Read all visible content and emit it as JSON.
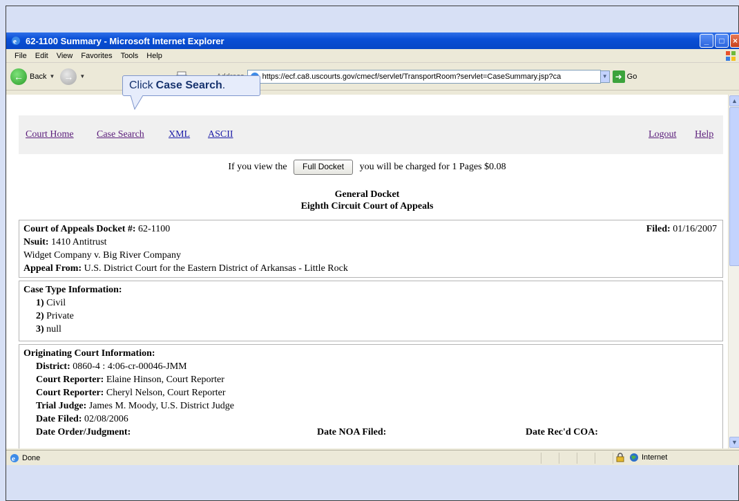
{
  "window": {
    "title": "62-1100 Summary - Microsoft Internet Explorer"
  },
  "menu": [
    "File",
    "Edit",
    "View",
    "Favorites",
    "Tools",
    "Help"
  ],
  "toolbar": {
    "back_label": "Back",
    "address_label": "Address",
    "address_url": "https://ecf.ca8.uscourts.gov/cmecf/servlet/TransportRoom?servlet=CaseSummary.jsp?ca",
    "go_label": "Go"
  },
  "callout": {
    "prefix": "Click",
    "bold": "Case Search",
    "suffix": "."
  },
  "nav": {
    "court_home": "Court Home",
    "case_search": "Case Search",
    "xml": "XML",
    "ascii": "ASCII",
    "logout": "Logout",
    "help": "Help"
  },
  "charge": {
    "prefix": "If you view the",
    "button": "Full Docket",
    "suffix": "you will be charged for 1 Pages $0.08"
  },
  "header": {
    "line1": "General Docket",
    "line2": "Eighth Circuit Court of Appeals"
  },
  "case": {
    "docket_label": "Court of Appeals Docket #:",
    "docket_value": " 62-1100",
    "filed_label": "Filed:",
    "filed_value": " 01/16/2007",
    "nsuit_label": "Nsuit:",
    "nsuit_value": " 1410 Antitrust",
    "parties": "Widget Company v. Big River Company",
    "appeal_label": "Appeal From:",
    "appeal_value": " U.S. District Court for the Eastern District of Arkansas - Little Rock"
  },
  "case_type": {
    "heading": "Case Type Information:",
    "items": [
      {
        "num": "1)",
        "text": " Civil"
      },
      {
        "num": "2)",
        "text": " Private"
      },
      {
        "num": "3)",
        "text": " null"
      }
    ]
  },
  "originating": {
    "heading": "Originating Court Information:",
    "district_label": "District:",
    "district_value": " 0860-4 : 4:06-cr-00046-JMM",
    "reporter1_label": "Court Reporter:",
    "reporter1_value": " Elaine Hinson, Court Reporter",
    "reporter2_label": "Court Reporter:",
    "reporter2_value": " Cheryl Nelson, Court Reporter",
    "judge_label": "Trial Judge:",
    "judge_value": " James M. Moody, U.S. District Judge",
    "date_filed_label": "Date Filed:",
    "date_filed_value": " 02/08/2006",
    "order_label": "Date Order/Judgment:",
    "noa_label": "Date NOA Filed:",
    "coa_label": "Date Rec'd COA:"
  },
  "status": {
    "text": "Done",
    "zone": "Internet"
  }
}
